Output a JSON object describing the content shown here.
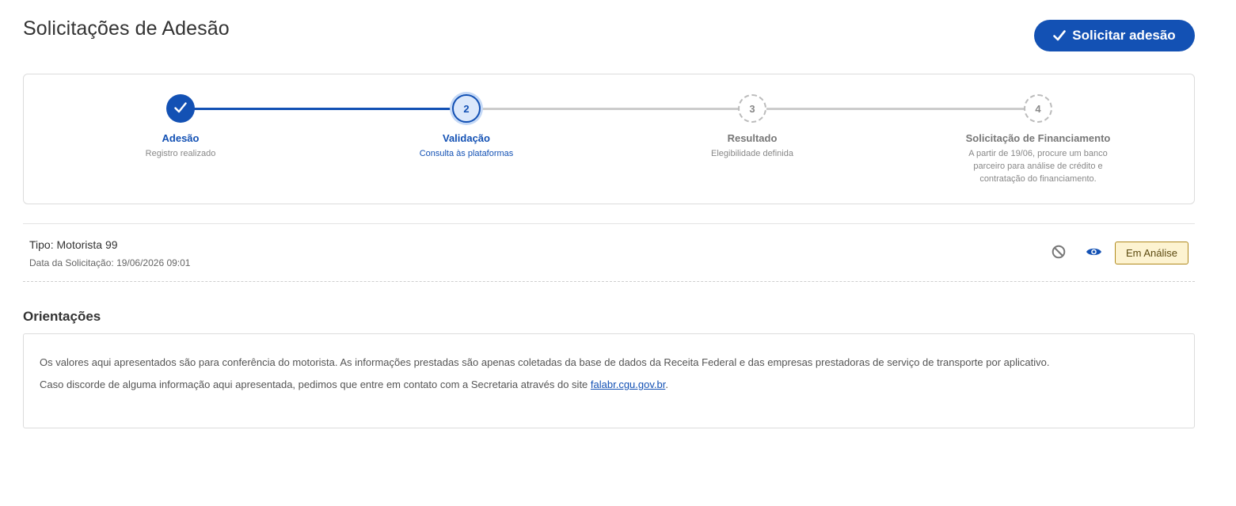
{
  "header": {
    "title": "Solicitações de Adesão",
    "primary_action_label": "Solicitar adesão"
  },
  "stepper": {
    "steps": [
      {
        "number": "1",
        "label": "Adesão",
        "description": "Registro realizado",
        "state": "completed"
      },
      {
        "number": "2",
        "label": "Validação",
        "description": "Consulta às plataformas",
        "state": "active"
      },
      {
        "number": "3",
        "label": "Resultado",
        "description": "Elegibilidade definida",
        "state": "pending"
      },
      {
        "number": "4",
        "label": "Solicitação de Financiamento",
        "description": "A partir de 19/06, procure um banco parceiro para análise de crédito e contratação do financiamento.",
        "state": "pending"
      }
    ]
  },
  "request": {
    "type_text": "Tipo: Motorista 99",
    "date_text": "Data da Solicitação: 19/06/2026 09:01",
    "status": "Em Análise",
    "actions": [
      "cancel-icon",
      "view-icon"
    ]
  },
  "guidelines": {
    "title": "Orientações",
    "line1": "Os valores aqui apresentados são para conferência do motorista. As informações prestadas são apenas coletadas da base de dados da Receita Federal e das empresas prestadoras de serviço de transporte por aplicativo.",
    "line2_prefix": "Caso discorde de alguma informação aqui apresentada, pedimos que entre em contato com a Secretaria através do site ",
    "link_text": "falabr.cgu.gov.br",
    "line2_suffix": "."
  },
  "colors": {
    "primary": "#1351b4",
    "step_pending": "#cccccc",
    "badge_bg": "#fdf3d1",
    "badge_border": "#b08a1e"
  }
}
